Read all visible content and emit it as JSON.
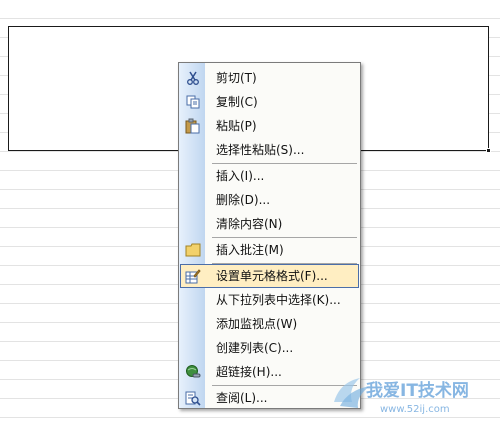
{
  "menu": {
    "items": [
      {
        "label": "剪切(T)",
        "icon": "scissors-icon"
      },
      {
        "label": "复制(C)",
        "icon": "copy-icon"
      },
      {
        "label": "粘贴(P)",
        "icon": "paste-icon"
      },
      {
        "label": "选择性粘贴(S)...",
        "icon": ""
      },
      {
        "label": "插入(I)...",
        "icon": ""
      },
      {
        "label": "删除(D)...",
        "icon": ""
      },
      {
        "label": "清除内容(N)",
        "icon": ""
      },
      {
        "label": "插入批注(M)",
        "icon": "comment-icon"
      },
      {
        "label": "设置单元格格式(F)...",
        "icon": "format-cells-icon",
        "highlighted": true
      },
      {
        "label": "从下拉列表中选择(K)...",
        "icon": ""
      },
      {
        "label": "添加监视点(W)",
        "icon": ""
      },
      {
        "label": "创建列表(C)...",
        "icon": ""
      },
      {
        "label": "超链接(H)...",
        "icon": "hyperlink-icon"
      },
      {
        "label": "查阅(L)...",
        "icon": "research-icon"
      }
    ]
  },
  "watermark": {
    "text": "我爱IT技术网",
    "url": "www.52ij.com"
  },
  "colors": {
    "highlight_fill": "#ffeec2",
    "highlight_border": "#4b6ea9",
    "gutter_light": "#e7f1fc",
    "gutter_dark": "#c0d6f0"
  }
}
